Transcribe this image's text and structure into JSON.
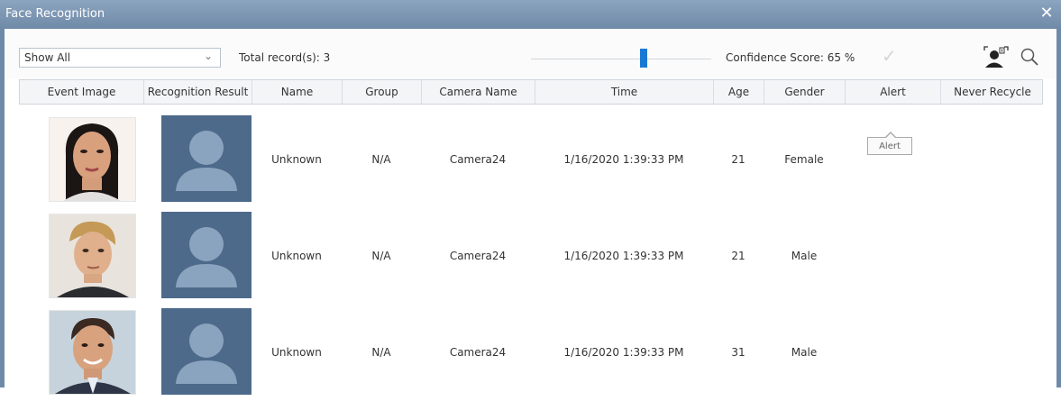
{
  "window": {
    "title": "Face Recognition",
    "close_icon": "close-icon"
  },
  "toolbar": {
    "filter": {
      "selected": "Show All"
    },
    "total_label": "Total record(s): 3",
    "confidence_label": "Confidence Score: 65 %",
    "confidence_value": 65,
    "icons": [
      "checkmark-icon",
      "face-profile-icon",
      "search-icon"
    ]
  },
  "table": {
    "columns": [
      "Event Image",
      "Recognition Result",
      "Name",
      "Group",
      "Camera Name",
      "Time",
      "Age",
      "Gender",
      "Alert",
      "Never Recycle"
    ],
    "rows": [
      {
        "name": "Unknown",
        "group": "N/A",
        "camera": "Camera24",
        "time": "1/16/2020 1:39:33 PM",
        "age": "21",
        "gender": "Female"
      },
      {
        "name": "Unknown",
        "group": "N/A",
        "camera": "Camera24",
        "time": "1/16/2020 1:39:33 PM",
        "age": "21",
        "gender": "Male"
      },
      {
        "name": "Unknown",
        "group": "N/A",
        "camera": "Camera24",
        "time": "1/16/2020 1:39:33 PM",
        "age": "31",
        "gender": "Male"
      }
    ]
  },
  "tooltip": {
    "text": "Alert"
  },
  "colors": {
    "titlebar": "#7a94b2",
    "placeholder_bg": "#4d6a8b",
    "slider_thumb": "#1978d4"
  }
}
